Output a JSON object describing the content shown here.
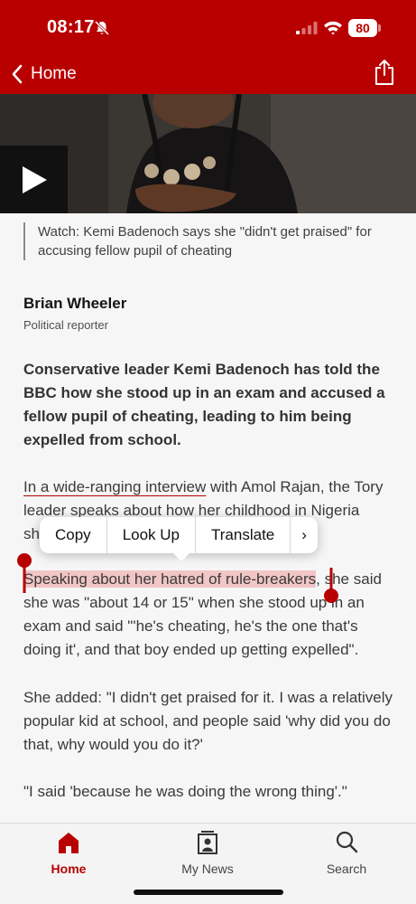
{
  "status_bar": {
    "time": "08:17",
    "battery": "80"
  },
  "nav": {
    "back_label": "Home"
  },
  "video": {
    "caption": "Watch: Kemi Badenoch says she \"didn't get praised\" for accusing fellow pupil of cheating"
  },
  "author": {
    "name": "Brian Wheeler",
    "role": "Political reporter"
  },
  "article": {
    "lead": "Conservative leader Kemi Badenoch has told the BBC how she stood up in an exam and accused a fellow pupil of cheating, leading to him being expelled from school.",
    "p1_link": "In a wide-ranging interview",
    "p1_rest": " with Amol Rajan, the Tory leader speaks about how her childhood in Nigeria shaped her.",
    "p2_selected": "Speaking about her hatred of rule-breakers",
    "p2_rest": ", she said she was \"about 14 or 15\" when she stood up in an exam and said \"'he's cheating, he's the one that's doing it', and that boy ended up getting expelled\".",
    "p3": "She added: \"I didn't get praised for it. I was a relatively popular kid at school, and people said 'why did you do that, why would you do it?'",
    "p4": "\"I said 'because he was doing the wrong thing'.\""
  },
  "context_menu": {
    "items": [
      "Copy",
      "Look Up",
      "Translate"
    ],
    "more": "›"
  },
  "tabbar": {
    "items": [
      {
        "label": "Home"
      },
      {
        "label": "My News"
      },
      {
        "label": "Search"
      }
    ]
  },
  "colors": {
    "brand_red": "#b80000",
    "selection": "#f2c6c6"
  },
  "icons": [
    "bell-slash-icon",
    "signal-icon",
    "wifi-icon",
    "battery-icon",
    "chevron-left-icon",
    "share-icon",
    "play-icon",
    "home-icon",
    "my-news-icon",
    "search-icon"
  ]
}
